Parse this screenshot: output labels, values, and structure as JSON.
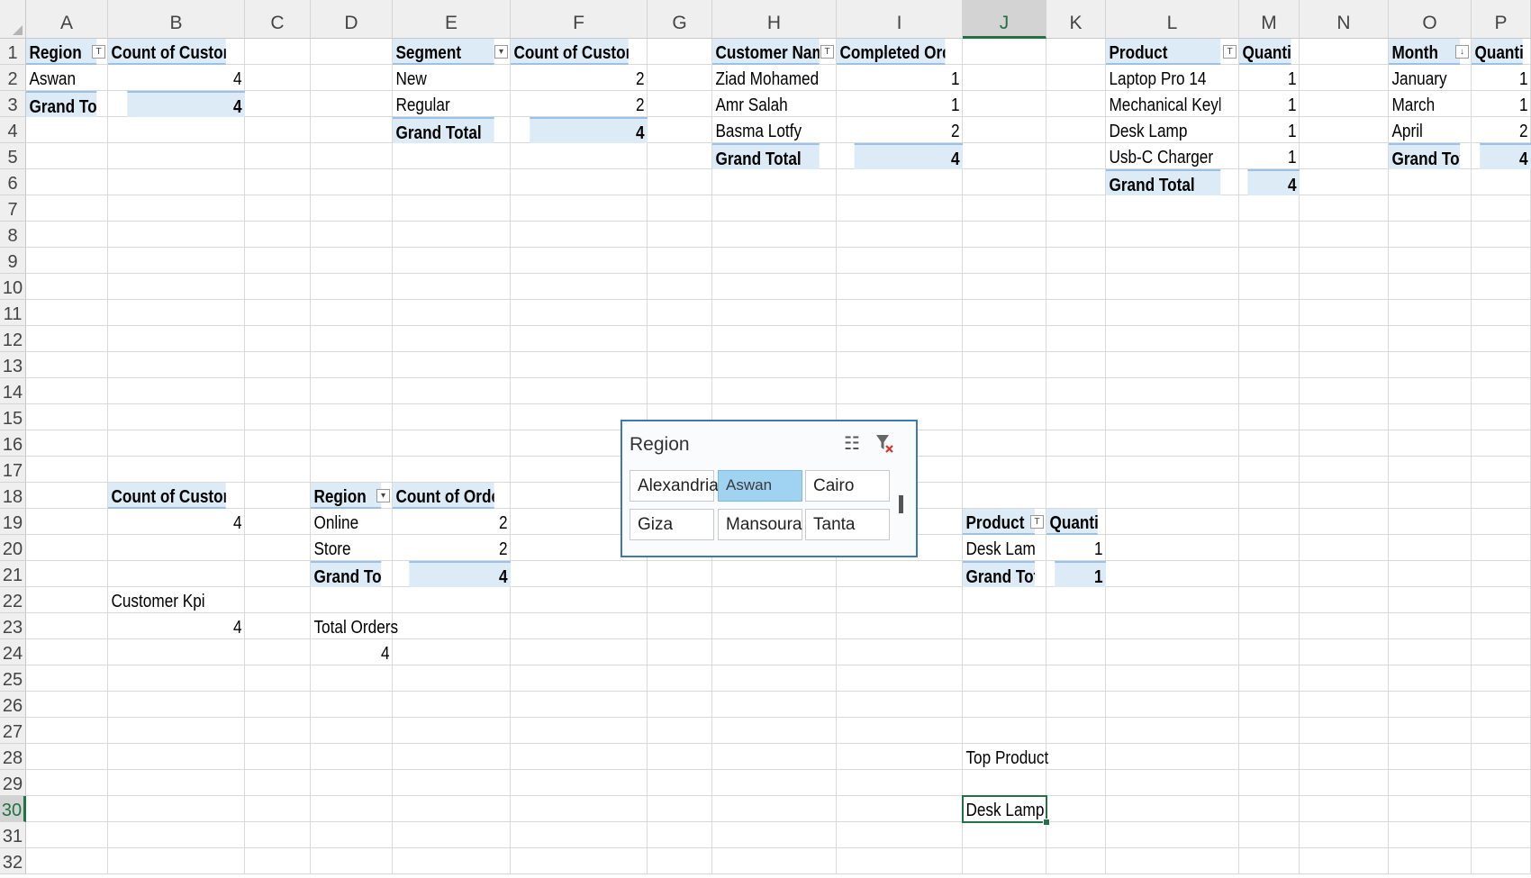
{
  "columns": [
    "A",
    "B",
    "C",
    "D",
    "E",
    "F",
    "G",
    "H",
    "I",
    "J",
    "K",
    "L",
    "M",
    "N",
    "O",
    "P"
  ],
  "selected_column": "J",
  "rows": [
    "1",
    "2",
    "3",
    "4",
    "5",
    "6",
    "7",
    "8",
    "9",
    "10",
    "11",
    "12",
    "13",
    "14",
    "15",
    "16",
    "17",
    "18",
    "19",
    "20",
    "21",
    "22",
    "23",
    "24",
    "25",
    "26",
    "27",
    "28",
    "29",
    "30",
    "31",
    "32"
  ],
  "selected_row": "30",
  "pivot_region": {
    "header": [
      "Region",
      "Count of Customers"
    ],
    "rows": [
      [
        "Aswan",
        "4"
      ]
    ],
    "total": [
      "Grand Total",
      "4"
    ]
  },
  "pivot_segment": {
    "header": [
      "Segment",
      "Count of Customers"
    ],
    "rows": [
      [
        "New",
        "2"
      ],
      [
        "Regular",
        "2"
      ]
    ],
    "total": [
      "Grand Total",
      "4"
    ]
  },
  "pivot_customer": {
    "header": [
      "Customer Name",
      "Completed Orders"
    ],
    "rows": [
      [
        "Ziad Mohamed",
        "1"
      ],
      [
        "Amr Salah",
        "1"
      ],
      [
        "Basma Lotfy",
        "2"
      ]
    ],
    "total": [
      "Grand Total",
      "4"
    ]
  },
  "pivot_product": {
    "header": [
      "Product",
      "Quantity"
    ],
    "rows": [
      [
        "Laptop Pro 14",
        "1"
      ],
      [
        "Mechanical Keyboard",
        "1"
      ],
      [
        "Desk Lamp",
        "1"
      ],
      [
        "Usb-C Charger",
        "1"
      ]
    ],
    "total": [
      "Grand Total",
      "4"
    ]
  },
  "pivot_month": {
    "header": [
      "Month",
      "Quantity"
    ],
    "rows": [
      [
        "January",
        "1"
      ],
      [
        "March",
        "1"
      ],
      [
        "April",
        "2"
      ]
    ],
    "total": [
      "Grand Total",
      "4"
    ]
  },
  "pivot_count": {
    "header": "Count of Customers",
    "value": "4"
  },
  "pivot_channel": {
    "header": [
      "Region",
      "Count of OrderID"
    ],
    "rows": [
      [
        "Online",
        "2"
      ],
      [
        "Store",
        "2"
      ]
    ],
    "total": [
      "Grand Total",
      "4"
    ]
  },
  "pivot_top_product": {
    "header": [
      "Product",
      "Quantity"
    ],
    "rows": [
      [
        "Desk Lamp",
        "1"
      ]
    ],
    "total": [
      "Grand Total",
      "1"
    ]
  },
  "kpi_customer": {
    "label": "Customer Kpi",
    "value": "4"
  },
  "kpi_orders": {
    "label": "Total Orders",
    "value": "4"
  },
  "top_product": {
    "label": "Top Product",
    "value": "Desk Lamp"
  },
  "slicer": {
    "title": "Region",
    "multi_select_icon": "multi-select-icon",
    "clear_filter_icon": "clear-filter-icon",
    "items": [
      "Alexandria",
      "Aswan",
      "Cairo",
      "Giza",
      "Mansoura",
      "Tanta"
    ],
    "selected": "Aswan",
    "selected_color": "#9fd3f1"
  },
  "colors": {
    "pivot_header": "#ddebf7",
    "pivot_border": "#9bc2e6",
    "active": "#217346"
  }
}
